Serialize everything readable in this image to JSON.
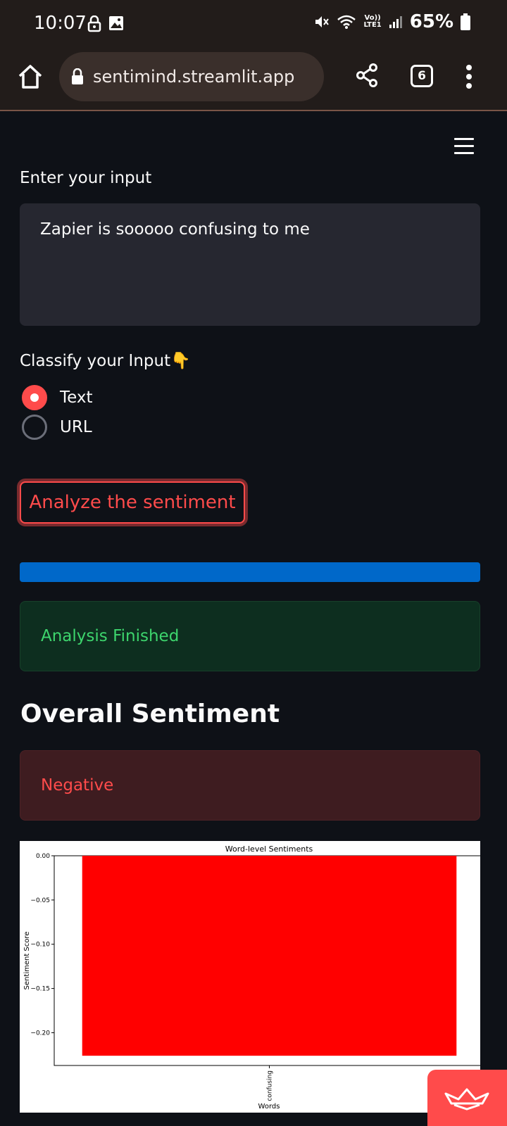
{
  "status_bar": {
    "time": "10:07",
    "battery": "65%",
    "network": "LTE1"
  },
  "browser": {
    "url": "sentimind.streamlit.app",
    "tab_count": "6"
  },
  "main": {
    "input_label": "Enter your input",
    "input_value": "Zapier is sooooo confusing to me",
    "classify_label": "Classify your Input👇",
    "radio_options": [
      {
        "label": "Text",
        "selected": true
      },
      {
        "label": "URL",
        "selected": false
      }
    ],
    "analyze_button": "Analyze the sentiment",
    "progress": 1.0,
    "success_message": "Analysis Finished",
    "overall_heading": "Overall Sentiment",
    "overall_result": "Negative"
  },
  "colors": {
    "accent": "#ff4b4b",
    "progress": "#0068c9",
    "success_text": "#3dd56d",
    "bar": "#ff0000",
    "background": "#0e1117"
  },
  "chart_data": {
    "type": "bar",
    "title": "Word-level Sentiments",
    "xlabel": "Words",
    "ylabel": "Sentiment Score",
    "categories": [
      "confusing"
    ],
    "values": [
      -0.226
    ],
    "ylim": [
      -0.237,
      0.0
    ],
    "yticks": [
      0.0,
      -0.05,
      -0.1,
      -0.15,
      -0.2
    ],
    "ytick_labels": [
      "0.00",
      "−0.05",
      "−0.10",
      "−0.15",
      "−0.20"
    ],
    "grid": false
  }
}
